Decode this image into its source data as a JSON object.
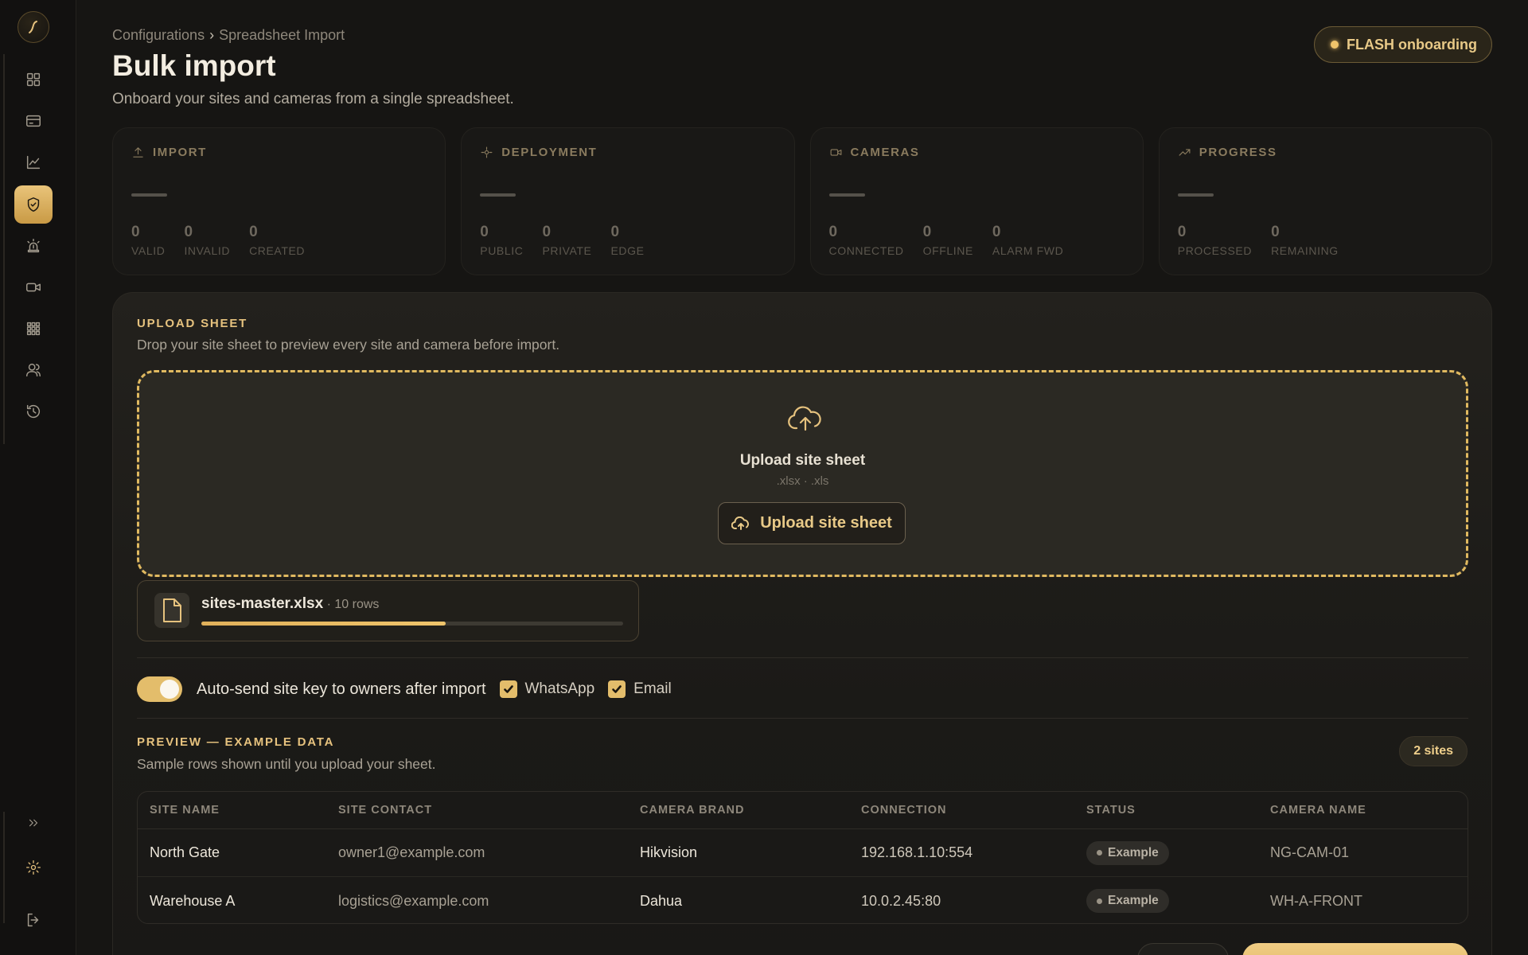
{
  "breadcrumb": {
    "parent": "Configurations",
    "separator": "›",
    "current": "Spreadsheet Import"
  },
  "header": {
    "title": "Bulk import",
    "subtitle": "Onboard your sites and cameras from a single spreadsheet.",
    "badge": "FLASH onboarding"
  },
  "sidebar": {
    "items": [
      {
        "icon": "dashboard-icon"
      },
      {
        "icon": "card-icon"
      },
      {
        "icon": "analytics-icon"
      },
      {
        "icon": "shield-check-icon",
        "active": true
      },
      {
        "icon": "alarm-icon"
      },
      {
        "icon": "video-camera-icon"
      },
      {
        "icon": "grid-icon"
      },
      {
        "icon": "users-icon"
      },
      {
        "icon": "history-icon"
      }
    ],
    "bottom": [
      {
        "icon": "expand-icon"
      },
      {
        "icon": "settings-icon"
      },
      {
        "icon": "logout-icon"
      }
    ]
  },
  "stats": {
    "import": {
      "label": "IMPORT",
      "metrics": [
        {
          "value": "0",
          "label": "VALID"
        },
        {
          "value": "0",
          "label": "INVALID"
        },
        {
          "value": "0",
          "label": "CREATED"
        }
      ]
    },
    "deployment": {
      "label": "DEPLOYMENT",
      "metrics": [
        {
          "value": "0",
          "label": "PUBLIC"
        },
        {
          "value": "0",
          "label": "PRIVATE"
        },
        {
          "value": "0",
          "label": "EDGE"
        }
      ]
    },
    "cameras": {
      "label": "CAMERAS",
      "metrics": [
        {
          "value": "0",
          "label": "CONNECTED"
        },
        {
          "value": "0",
          "label": "OFFLINE"
        },
        {
          "value": "0",
          "label": "ALARM FWD"
        }
      ]
    },
    "progress": {
      "label": "PROGRESS",
      "metrics": [
        {
          "value": "0",
          "label": "PROCESSED"
        },
        {
          "value": "0",
          "label": "REMAINING"
        }
      ]
    }
  },
  "upload": {
    "title": "UPLOAD SHEET",
    "subtitle": "Drop your site sheet to preview every site and camera before import.",
    "dropzone_title": "Upload site sheet",
    "formats": ".xlsx · .xls",
    "button_label": "Upload site sheet",
    "file": {
      "name": "sites-master.xlsx",
      "rows": " · 10 rows",
      "progress": 0.58
    }
  },
  "options": {
    "auto_send_label": "Auto-send site key to owners after import",
    "auto_send_on": true,
    "whatsapp_label": "WhatsApp",
    "email_label": "Email"
  },
  "preview": {
    "title": "PREVIEW — EXAMPLE DATA",
    "subtitle": "Sample rows shown until you upload your sheet.",
    "count_badge": "2 sites",
    "columns": [
      "SITE NAME",
      "SITE CONTACT",
      "CAMERA BRAND",
      "CONNECTION",
      "STATUS",
      "CAMERA NAME"
    ],
    "rows": [
      {
        "site_name": "North Gate",
        "site_contact": "owner1@example.com",
        "camera_brand": "Hikvision",
        "connection": "192.168.1.10:554",
        "status": "Example",
        "camera_name": "NG-CAM-01"
      },
      {
        "site_name": "Warehouse A",
        "site_contact": "logistics@example.com",
        "camera_brand": "Dahua",
        "connection": "10.0.2.45:80",
        "status": "Example",
        "camera_name": "WH-A-FRONT"
      }
    ]
  },
  "colors": {
    "accent": "#e6c27e",
    "background": "#161513",
    "active_nav": "#e3bd6b"
  }
}
